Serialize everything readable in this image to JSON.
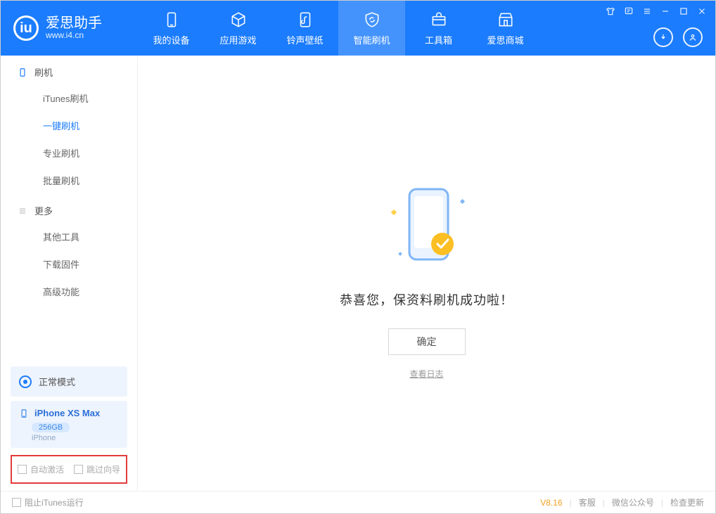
{
  "logo": {
    "title": "爱思助手",
    "subtitle": "www.i4.cn",
    "mark": "iu"
  },
  "tabs": [
    {
      "label": "我的设备"
    },
    {
      "label": "应用游戏"
    },
    {
      "label": "铃声壁纸"
    },
    {
      "label": "智能刷机"
    },
    {
      "label": "工具箱"
    },
    {
      "label": "爱思商城"
    }
  ],
  "sidebar": {
    "section1": {
      "title": "刷机",
      "items": [
        "iTunes刷机",
        "一键刷机",
        "专业刷机",
        "批量刷机"
      ]
    },
    "section2": {
      "title": "更多",
      "items": [
        "其他工具",
        "下载固件",
        "高级功能"
      ]
    }
  },
  "status": {
    "mode": "正常模式"
  },
  "device": {
    "name": "iPhone XS Max",
    "capacity": "256GB",
    "type": "iPhone"
  },
  "checks": {
    "auto_activate": "自动激活",
    "skip_guide": "跳过向导"
  },
  "main": {
    "success_message": "恭喜您，保资料刷机成功啦！",
    "ok_button": "确定",
    "view_log": "查看日志"
  },
  "footer": {
    "block_itunes": "阻止iTunes运行",
    "version": "V8.16",
    "support": "客服",
    "wechat": "微信公众号",
    "update": "检查更新"
  }
}
